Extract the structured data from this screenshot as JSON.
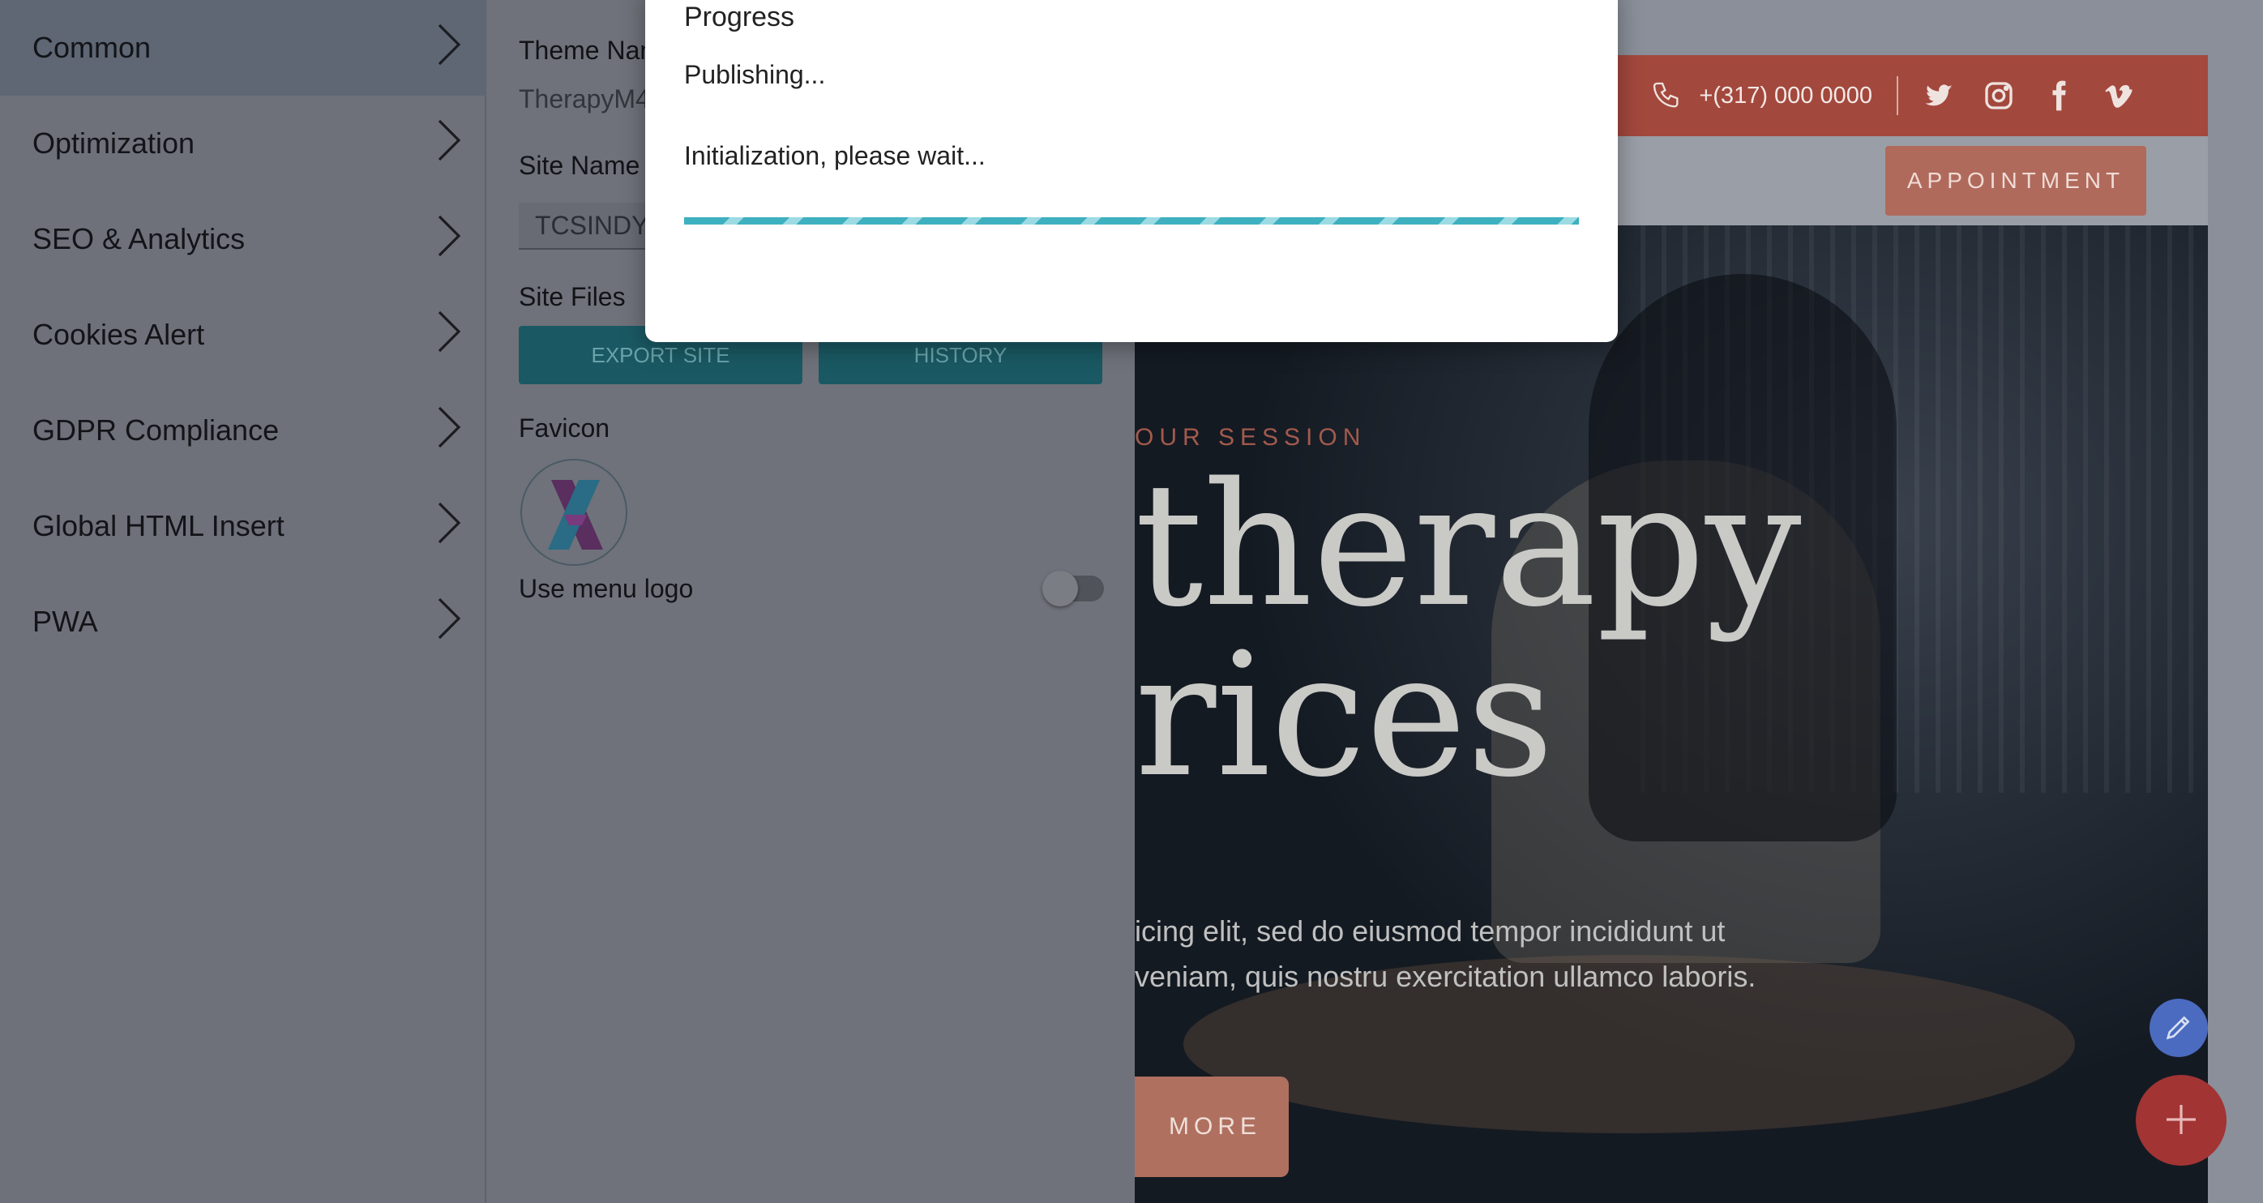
{
  "sidebar": {
    "items": [
      {
        "label": "Common",
        "active": true
      },
      {
        "label": "Optimization"
      },
      {
        "label": "SEO & Analytics"
      },
      {
        "label": "Cookies Alert"
      },
      {
        "label": "GDPR Compliance"
      },
      {
        "label": "Global HTML Insert"
      },
      {
        "label": "PWA"
      }
    ]
  },
  "panel": {
    "theme_name_label": "Theme Nam",
    "theme_name_value": "TherapyM4-",
    "site_name_label": "Site Name",
    "site_name_value": "TCSINDY",
    "site_files_label": "Site Files",
    "export_label": "EXPORT SITE",
    "history_label": "HISTORY",
    "favicon_label": "Favicon",
    "use_menu_logo_label": "Use menu logo",
    "use_menu_logo_on": false
  },
  "modal": {
    "title": "Progress",
    "status": "Publishing...",
    "message": "Initialization, please wait...",
    "progress_fraction": 1.0
  },
  "preview": {
    "phone": "+(317) 000 0000",
    "appointment_label": "APPOINTMENT",
    "eyebrow": "OUR SESSION",
    "hero_line1": "therapy",
    "hero_line2": "rices",
    "hero_para1": "icing elit, sed do eiusmod tempor incididunt ut",
    "hero_para2": "veniam, quis nostru exercitation ullamco laboris.",
    "more_label": "MORE",
    "social_icons": [
      "twitter-icon",
      "instagram-icon",
      "facebook-icon",
      "vimeo-icon"
    ]
  },
  "colors": {
    "accent_teal": "#3eb0c0",
    "brand_red": "#a3483d",
    "fab_red": "#a23434",
    "fab_blue": "#4a6bbf"
  }
}
